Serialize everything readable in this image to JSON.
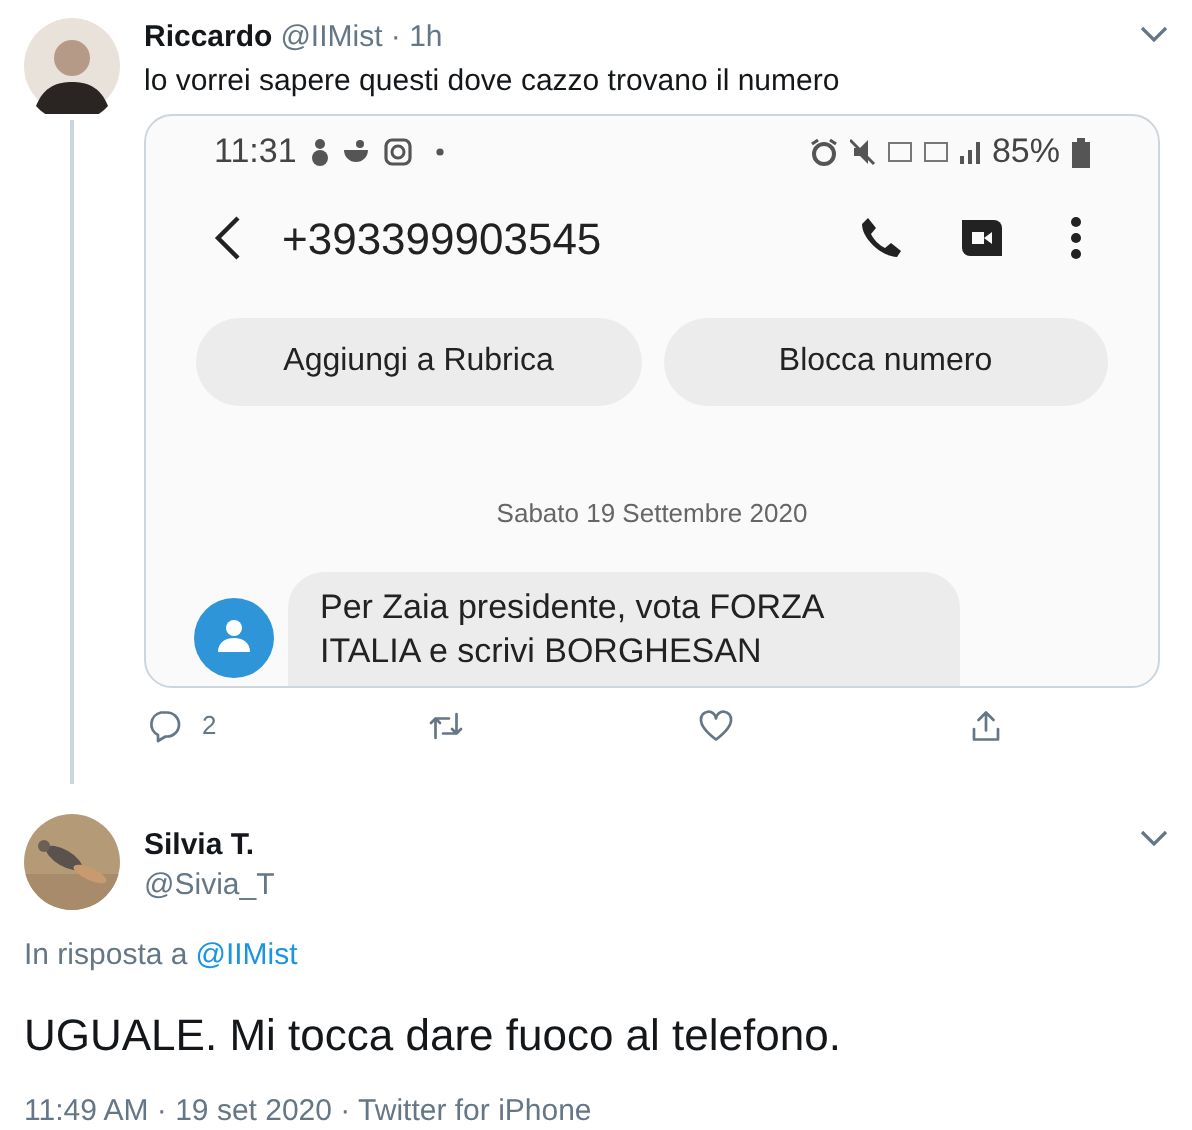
{
  "parent_tweet": {
    "name": "Riccardo",
    "handle_time": "@IIMist · 1h",
    "text": "lo vorrei sapere questi dove cazzo trovano il numero",
    "media": {
      "status_time": "11:31",
      "battery": "85%",
      "contact_number": "+393399903545",
      "buttons": [
        "Aggiungi a Rubrica",
        "Blocca numero"
      ],
      "date": "Sabato 19 Settembre 2020",
      "message": "Per Zaia presidente, vota FORZA ITALIA e scrivi BORGHESAN"
    },
    "reply_count": "2"
  },
  "reply_tweet": {
    "name": "Silvia T.",
    "handle": "@Sivia_T",
    "reply_label": "In risposta a",
    "reply_to": "@IIMist",
    "text": "UGUALE. Mi tocca dare fuoco al telefono.",
    "footer": "11:49 AM · 19 set 2020 · Twitter for iPhone"
  }
}
